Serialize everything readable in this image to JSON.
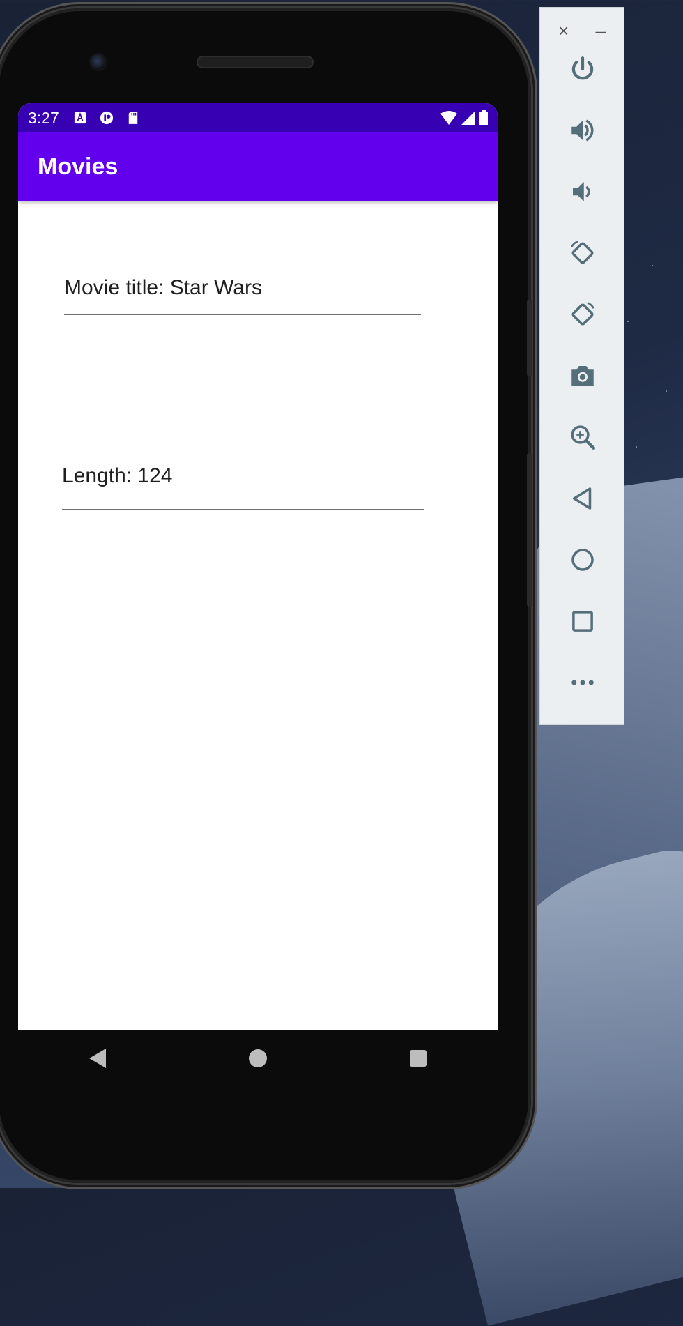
{
  "status_bar": {
    "time": "3:27"
  },
  "app_bar": {
    "title": "Movies"
  },
  "form": {
    "movie_title": "Movie title: Star Wars",
    "length": "Length: 124"
  },
  "emulator_toolbar": {
    "close_label": "×",
    "minimize_label": "–",
    "buttons": [
      "power",
      "volume-up",
      "volume-down",
      "rotate-left",
      "rotate-right",
      "screenshot",
      "zoom",
      "back",
      "home",
      "overview",
      "more"
    ]
  },
  "colors": {
    "status_bar": "#3700b3",
    "app_bar": "#6200ee",
    "toolbar_icon": "#546e7a"
  }
}
